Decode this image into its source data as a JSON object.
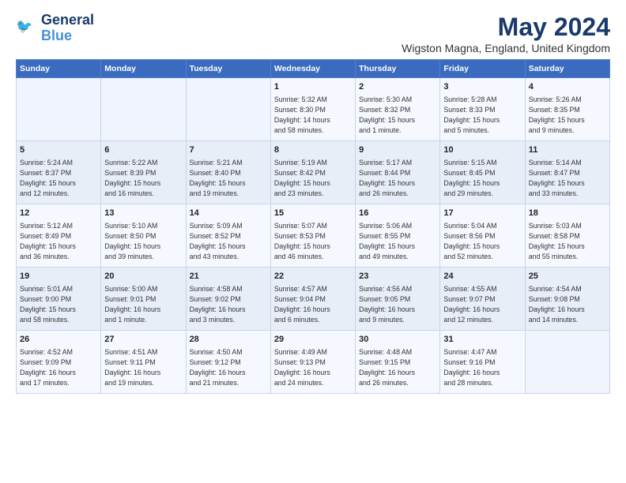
{
  "logo": {
    "line1": "General",
    "line2": "Blue"
  },
  "title": "May 2024",
  "subtitle": "Wigston Magna, England, United Kingdom",
  "days_of_week": [
    "Sunday",
    "Monday",
    "Tuesday",
    "Wednesday",
    "Thursday",
    "Friday",
    "Saturday"
  ],
  "weeks": [
    [
      {
        "day": "",
        "info": ""
      },
      {
        "day": "",
        "info": ""
      },
      {
        "day": "",
        "info": ""
      },
      {
        "day": "1",
        "info": "Sunrise: 5:32 AM\nSunset: 8:30 PM\nDaylight: 14 hours\nand 58 minutes."
      },
      {
        "day": "2",
        "info": "Sunrise: 5:30 AM\nSunset: 8:32 PM\nDaylight: 15 hours\nand 1 minute."
      },
      {
        "day": "3",
        "info": "Sunrise: 5:28 AM\nSunset: 8:33 PM\nDaylight: 15 hours\nand 5 minutes."
      },
      {
        "day": "4",
        "info": "Sunrise: 5:26 AM\nSunset: 8:35 PM\nDaylight: 15 hours\nand 9 minutes."
      }
    ],
    [
      {
        "day": "5",
        "info": "Sunrise: 5:24 AM\nSunset: 8:37 PM\nDaylight: 15 hours\nand 12 minutes."
      },
      {
        "day": "6",
        "info": "Sunrise: 5:22 AM\nSunset: 8:39 PM\nDaylight: 15 hours\nand 16 minutes."
      },
      {
        "day": "7",
        "info": "Sunrise: 5:21 AM\nSunset: 8:40 PM\nDaylight: 15 hours\nand 19 minutes."
      },
      {
        "day": "8",
        "info": "Sunrise: 5:19 AM\nSunset: 8:42 PM\nDaylight: 15 hours\nand 23 minutes."
      },
      {
        "day": "9",
        "info": "Sunrise: 5:17 AM\nSunset: 8:44 PM\nDaylight: 15 hours\nand 26 minutes."
      },
      {
        "day": "10",
        "info": "Sunrise: 5:15 AM\nSunset: 8:45 PM\nDaylight: 15 hours\nand 29 minutes."
      },
      {
        "day": "11",
        "info": "Sunrise: 5:14 AM\nSunset: 8:47 PM\nDaylight: 15 hours\nand 33 minutes."
      }
    ],
    [
      {
        "day": "12",
        "info": "Sunrise: 5:12 AM\nSunset: 8:49 PM\nDaylight: 15 hours\nand 36 minutes."
      },
      {
        "day": "13",
        "info": "Sunrise: 5:10 AM\nSunset: 8:50 PM\nDaylight: 15 hours\nand 39 minutes."
      },
      {
        "day": "14",
        "info": "Sunrise: 5:09 AM\nSunset: 8:52 PM\nDaylight: 15 hours\nand 43 minutes."
      },
      {
        "day": "15",
        "info": "Sunrise: 5:07 AM\nSunset: 8:53 PM\nDaylight: 15 hours\nand 46 minutes."
      },
      {
        "day": "16",
        "info": "Sunrise: 5:06 AM\nSunset: 8:55 PM\nDaylight: 15 hours\nand 49 minutes."
      },
      {
        "day": "17",
        "info": "Sunrise: 5:04 AM\nSunset: 8:56 PM\nDaylight: 15 hours\nand 52 minutes."
      },
      {
        "day": "18",
        "info": "Sunrise: 5:03 AM\nSunset: 8:58 PM\nDaylight: 15 hours\nand 55 minutes."
      }
    ],
    [
      {
        "day": "19",
        "info": "Sunrise: 5:01 AM\nSunset: 9:00 PM\nDaylight: 15 hours\nand 58 minutes."
      },
      {
        "day": "20",
        "info": "Sunrise: 5:00 AM\nSunset: 9:01 PM\nDaylight: 16 hours\nand 1 minute."
      },
      {
        "day": "21",
        "info": "Sunrise: 4:58 AM\nSunset: 9:02 PM\nDaylight: 16 hours\nand 3 minutes."
      },
      {
        "day": "22",
        "info": "Sunrise: 4:57 AM\nSunset: 9:04 PM\nDaylight: 16 hours\nand 6 minutes."
      },
      {
        "day": "23",
        "info": "Sunrise: 4:56 AM\nSunset: 9:05 PM\nDaylight: 16 hours\nand 9 minutes."
      },
      {
        "day": "24",
        "info": "Sunrise: 4:55 AM\nSunset: 9:07 PM\nDaylight: 16 hours\nand 12 minutes."
      },
      {
        "day": "25",
        "info": "Sunrise: 4:54 AM\nSunset: 9:08 PM\nDaylight: 16 hours\nand 14 minutes."
      }
    ],
    [
      {
        "day": "26",
        "info": "Sunrise: 4:52 AM\nSunset: 9:09 PM\nDaylight: 16 hours\nand 17 minutes."
      },
      {
        "day": "27",
        "info": "Sunrise: 4:51 AM\nSunset: 9:11 PM\nDaylight: 16 hours\nand 19 minutes."
      },
      {
        "day": "28",
        "info": "Sunrise: 4:50 AM\nSunset: 9:12 PM\nDaylight: 16 hours\nand 21 minutes."
      },
      {
        "day": "29",
        "info": "Sunrise: 4:49 AM\nSunset: 9:13 PM\nDaylight: 16 hours\nand 24 minutes."
      },
      {
        "day": "30",
        "info": "Sunrise: 4:48 AM\nSunset: 9:15 PM\nDaylight: 16 hours\nand 26 minutes."
      },
      {
        "day": "31",
        "info": "Sunrise: 4:47 AM\nSunset: 9:16 PM\nDaylight: 16 hours\nand 28 minutes."
      },
      {
        "day": "",
        "info": ""
      }
    ]
  ]
}
